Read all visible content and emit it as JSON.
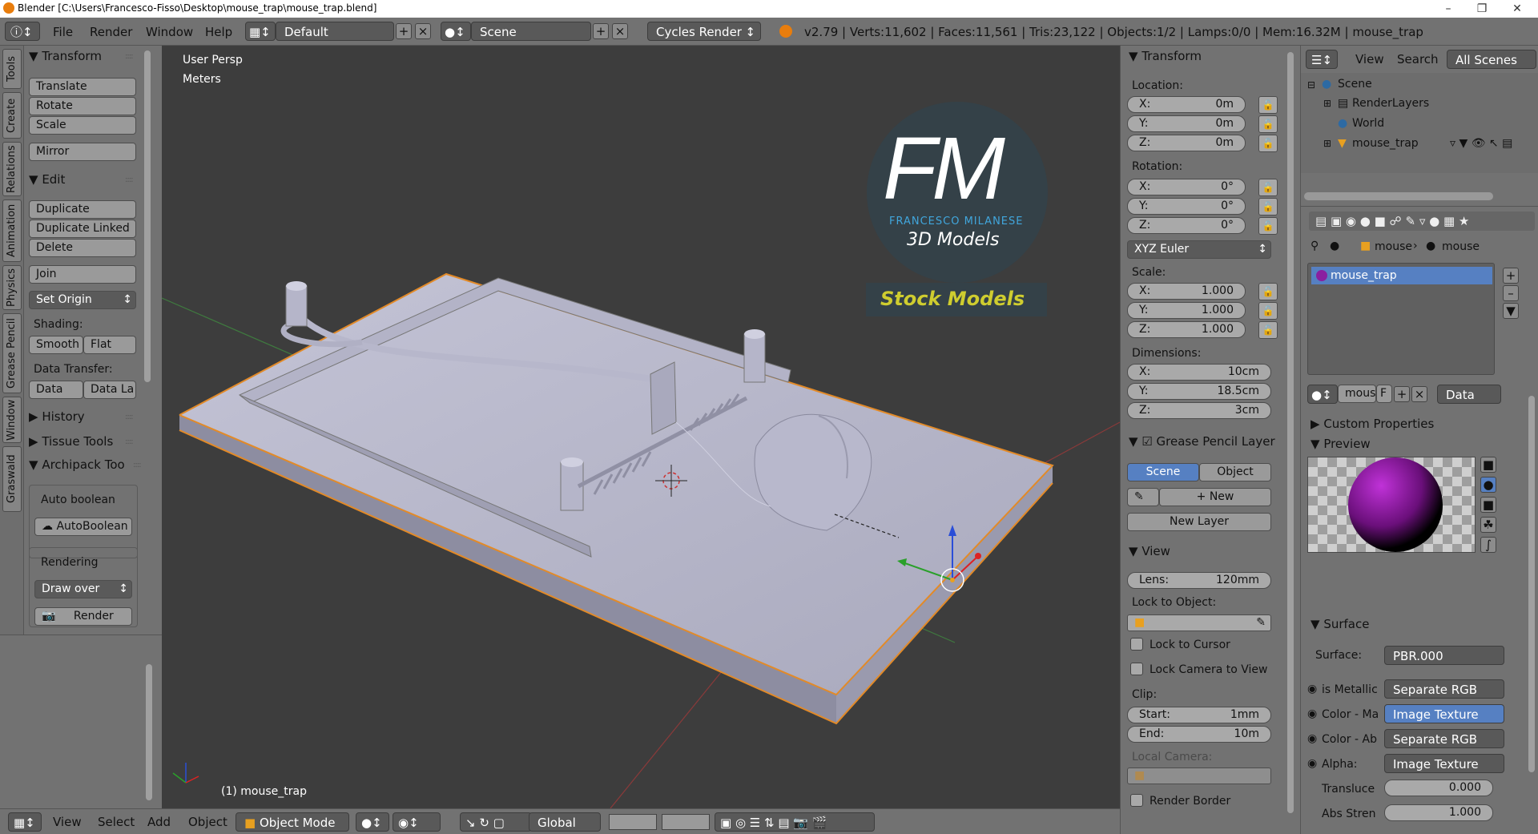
{
  "window": {
    "title": "Blender [C:\\Users\\Francesco-Fisso\\Desktop\\mouse_trap\\mouse_trap.blend]"
  },
  "menubar": {
    "items": [
      "File",
      "Render",
      "Window",
      "Help"
    ],
    "layout": "Default",
    "scene": "Scene",
    "engine": "Cycles Render",
    "stats": "v2.79 | Verts:11,602 | Faces:11,561 | Tris:23,122 | Objects:1/2 | Lamps:0/0 | Mem:16.32M | mouse_trap"
  },
  "left_tabs": [
    "Tools",
    "Create",
    "Relations",
    "Animation",
    "Physics",
    "Grease Pencil",
    "Window",
    "Graswald"
  ],
  "tools": {
    "transform_header": "Transform",
    "translate": "Translate",
    "rotate": "Rotate",
    "scale": "Scale",
    "mirror": "Mirror",
    "edit_header": "Edit",
    "duplicate": "Duplicate",
    "duplicate_linked": "Duplicate Linked",
    "delete": "Delete",
    "join": "Join",
    "set_origin": "Set Origin",
    "shading_label": "Shading:",
    "smooth": "Smooth",
    "flat": "Flat",
    "data_transfer_label": "Data Transfer:",
    "data": "Data",
    "data_la": "Data La",
    "history": "History",
    "tissue_tools": "Tissue Tools",
    "archipack": "Archipack Too",
    "auto_boolean_label": "Auto boolean",
    "autoboolean_btn": "AutoBoolean",
    "rendering_label": "Rendering",
    "draw_over": "Draw over",
    "render": "Render"
  },
  "viewport": {
    "view_name": "User Persp",
    "units": "Meters",
    "object_label": "(1) mouse_trap",
    "logo_letters": "FM",
    "logo_name": "FRANCESCO MILANESE",
    "logo_sub": "3D Models",
    "logo_stock": "Stock Models"
  },
  "bottombar": {
    "view": "View",
    "select": "Select",
    "add": "Add",
    "object": "Object",
    "mode": "Object Mode",
    "orientation": "Global"
  },
  "npanel": {
    "transform_header": "Transform",
    "location_label": "Location:",
    "location": [
      {
        "k": "X:",
        "v": "0m"
      },
      {
        "k": "Y:",
        "v": "0m"
      },
      {
        "k": "Z:",
        "v": "0m"
      }
    ],
    "rotation_label": "Rotation:",
    "rotation": [
      {
        "k": "X:",
        "v": "0°"
      },
      {
        "k": "Y:",
        "v": "0°"
      },
      {
        "k": "Z:",
        "v": "0°"
      }
    ],
    "rotation_mode": "XYZ Euler",
    "scale_label": "Scale:",
    "scale": [
      {
        "k": "X:",
        "v": "1.000"
      },
      {
        "k": "Y:",
        "v": "1.000"
      },
      {
        "k": "Z:",
        "v": "1.000"
      }
    ],
    "dimensions_label": "Dimensions:",
    "dimensions": [
      {
        "k": "X:",
        "v": "10cm"
      },
      {
        "k": "Y:",
        "v": "18.5cm"
      },
      {
        "k": "Z:",
        "v": "3cm"
      }
    ],
    "grease_header": "Grease Pencil Layer",
    "scene_tab": "Scene",
    "object_tab": "Object",
    "new": "New",
    "new_layer": "New Layer",
    "view_header": "View",
    "lens_k": "Lens:",
    "lens_v": "120mm",
    "lock_to_object": "Lock to Object:",
    "lock_to_cursor": "Lock to Cursor",
    "lock_camera": "Lock Camera to View",
    "clip_label": "Clip:",
    "clip_start_k": "Start:",
    "clip_start_v": "1mm",
    "clip_end_k": "End:",
    "clip_end_v": "10m",
    "local_camera": "Local Camera:",
    "render_border": "Render Border"
  },
  "outliner": {
    "view": "View",
    "search": "Search",
    "all_scenes": "All Scenes",
    "items": [
      "Scene",
      "RenderLayers",
      "World",
      "mouse_trap"
    ]
  },
  "properties": {
    "breadcrumb_obj": "mouse",
    "breadcrumb_mat": "mouse",
    "material_slot": "mouse_trap",
    "mat_name": "mous",
    "mat_f": "F",
    "data_dd": "Data",
    "custom_props": "Custom Properties",
    "preview": "Preview",
    "surface_header": "Surface",
    "surface_label": "Surface:",
    "surface_value": "PBR.000",
    "rows": [
      {
        "k": "is Metallic",
        "v": "Separate RGB"
      },
      {
        "k": "Color - Ma",
        "v": "Image Texture"
      },
      {
        "k": "Color - Ab",
        "v": "Separate RGB"
      },
      {
        "k": "Alpha:",
        "v": "Image Texture"
      }
    ],
    "translucent_k": "Transluce",
    "translucent_v": "0.000",
    "abs_k": "Abs Stren",
    "abs_v": "1.000"
  }
}
